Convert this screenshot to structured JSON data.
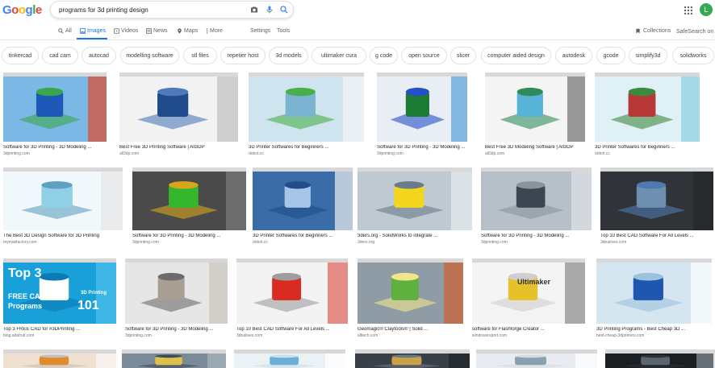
{
  "logo": {
    "letters": [
      "G",
      "o",
      "o",
      "g",
      "l",
      "e"
    ],
    "colors": [
      "#4285f4",
      "#ea4335",
      "#fbbc05",
      "#4285f4",
      "#34a853",
      "#ea4335"
    ]
  },
  "search": {
    "value": "programs for 3d printing design"
  },
  "user": {
    "initial": "L",
    "color": "#34a853"
  },
  "tabs": [
    {
      "label": "All",
      "icon": "search-icon"
    },
    {
      "label": "Images",
      "icon": "image-icon"
    },
    {
      "label": "Videos",
      "icon": "video-icon"
    },
    {
      "label": "News",
      "icon": "news-icon"
    },
    {
      "label": "Maps",
      "icon": "pin-icon"
    },
    {
      "label": "More",
      "icon": "more-icon"
    },
    {
      "label": "Settings"
    },
    {
      "label": "Tools"
    }
  ],
  "collections": "Collections",
  "safesearch": "SafeSearch on",
  "accent": "#1a73e8",
  "chips": [
    "tinkercad",
    "cad cam",
    "autocad",
    "modelling software",
    "stl files",
    "repetier host",
    "3d models",
    "ultimaker cura",
    "g code",
    "open source",
    "slicer",
    "computer aided design",
    "autodesk",
    "gcode",
    "simplify3d",
    "solidworks"
  ],
  "results": [
    {
      "title": "Software for 3D Printing - 3D Modeling ...",
      "source": "3dprinting.com"
    },
    {
      "title": "Best Free 3D Printing Software | All3DP",
      "source": "all3dp.com"
    },
    {
      "title": "3D Printer Softwares for Beginners ...",
      "source": "dobot.cc"
    },
    {
      "title": "Software for 3D Printing - 3D Modeling ...",
      "source": "3dprinting.com"
    },
    {
      "title": "Best Free 3D Modeling Software | All3DP",
      "source": "all3dp.com"
    },
    {
      "title": "3D Printer Softwares for Beginners ...",
      "source": "dobot.cc"
    },
    {
      "title": "The Best 3D Design Software for 3D Printing",
      "source": "mymakfactory.com"
    },
    {
      "title": "Software for 3D Printing - 3D Modeling ...",
      "source": "3dprinting.com"
    },
    {
      "title": "3D Printer Softwares for Beginners ...",
      "source": "dobot.cc"
    },
    {
      "title": "3ders.org - SolidWorks to integrate ...",
      "source": "3ders.org"
    },
    {
      "title": "Software for 3D Printing - 3D Modeling ...",
      "source": "3dprinting.com"
    },
    {
      "title": "Top 10 Best CAD Software For All Levels ...",
      "source": "3dnatives.com"
    },
    {
      "title": "Top 3 FREE CAD for #3DPrinting ...",
      "source": "blog.adafruit.com",
      "overlay": [
        "Top 3",
        "FREE CAD",
        "Programs",
        "3D Printing",
        "101"
      ]
    },
    {
      "title": "Software for 3D Printing - 3D Modeling ...",
      "source": "3dprinting.com"
    },
    {
      "title": "Top 10 Best CAD Software For All Levels ...",
      "source": "3dnatives.com"
    },
    {
      "title": "Geomagic® Claytools® | Solid ...",
      "source": "alltech.com"
    },
    {
      "title": "software for Flashforge Creator ...",
      "source": "windowsreport.com",
      "overlay": [
        "Ultimaker"
      ]
    },
    {
      "title": "3D Printing Programs - Best Cheap 3D ...",
      "source": "best-cheap-3dprinters.com"
    },
    {
      "title": "",
      "source": ""
    },
    {
      "title": "",
      "source": ""
    },
    {
      "title": "",
      "source": ""
    },
    {
      "title": "",
      "source": ""
    },
    {
      "title": "",
      "source": ""
    },
    {
      "title": "",
      "source": ""
    },
    {
      "title": "",
      "source": ""
    }
  ]
}
